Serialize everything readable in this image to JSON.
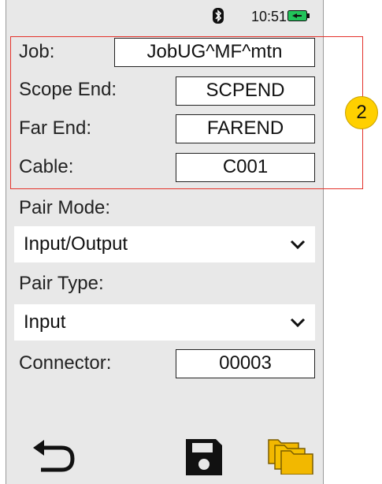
{
  "status": {
    "time": "10:51"
  },
  "form": {
    "job_label": "Job:",
    "job_value": "JobUG^MF^mtn",
    "scope_end_label": "Scope End:",
    "scope_end_value": "SCPEND",
    "far_end_label": "Far End:",
    "far_end_value": "FAREND",
    "cable_label": "Cable:",
    "cable_value": "C001",
    "pair_mode_label": "Pair Mode:",
    "pair_mode_value": "Input/Output",
    "pair_type_label": "Pair Type:",
    "pair_type_value": "Input",
    "connector_label": "Connector:",
    "connector_value": "00003"
  },
  "annotation": {
    "callout_number": "2"
  },
  "icons": {
    "bluetooth": "bluetooth-icon",
    "battery": "battery-charging-icon",
    "back": "back-arrow-icon",
    "save": "save-icon",
    "folders": "folders-icon"
  },
  "colors": {
    "device_bg": "#e8e8e8",
    "highlight_border": "#e4322b",
    "callout_fill": "#ffd000",
    "battery_green": "#22c35a",
    "folder_yellow": "#f2b800"
  }
}
